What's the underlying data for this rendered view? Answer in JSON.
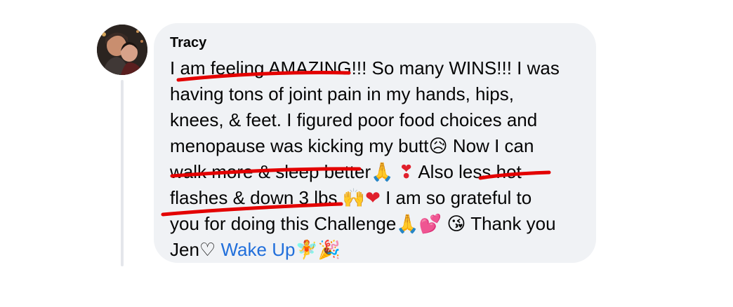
{
  "comment": {
    "author": "Tracy",
    "lines": [
      "I am feeling AMAZING!!! So many WINS!!! I was",
      "having tons of joint pain in my hands, hips,",
      "knees, & feet. I figured poor food choices and",
      "menopause was kicking my butt",
      "Now I can",
      "walk more & sleep better",
      "Also less hot",
      "flashes & down 3 lbs",
      "I am so grateful to",
      "you for doing this Challenge",
      "Thank you",
      "Jen♡",
      "Wake Up"
    ],
    "emojis": {
      "sad_sweat": "😥",
      "folded_hands": "🙏",
      "exclamation": "❣",
      "raising_hands": "🙌",
      "red_heart": "❤",
      "two_hearts": "💕",
      "kiss_face": "😘",
      "fairy": "🧚",
      "party_popper": "🎉"
    }
  },
  "colors": {
    "bubble": "#f0f2f5",
    "link": "#216fdb",
    "highlight": "#e30000",
    "thread_line": "#e4e6eb"
  }
}
